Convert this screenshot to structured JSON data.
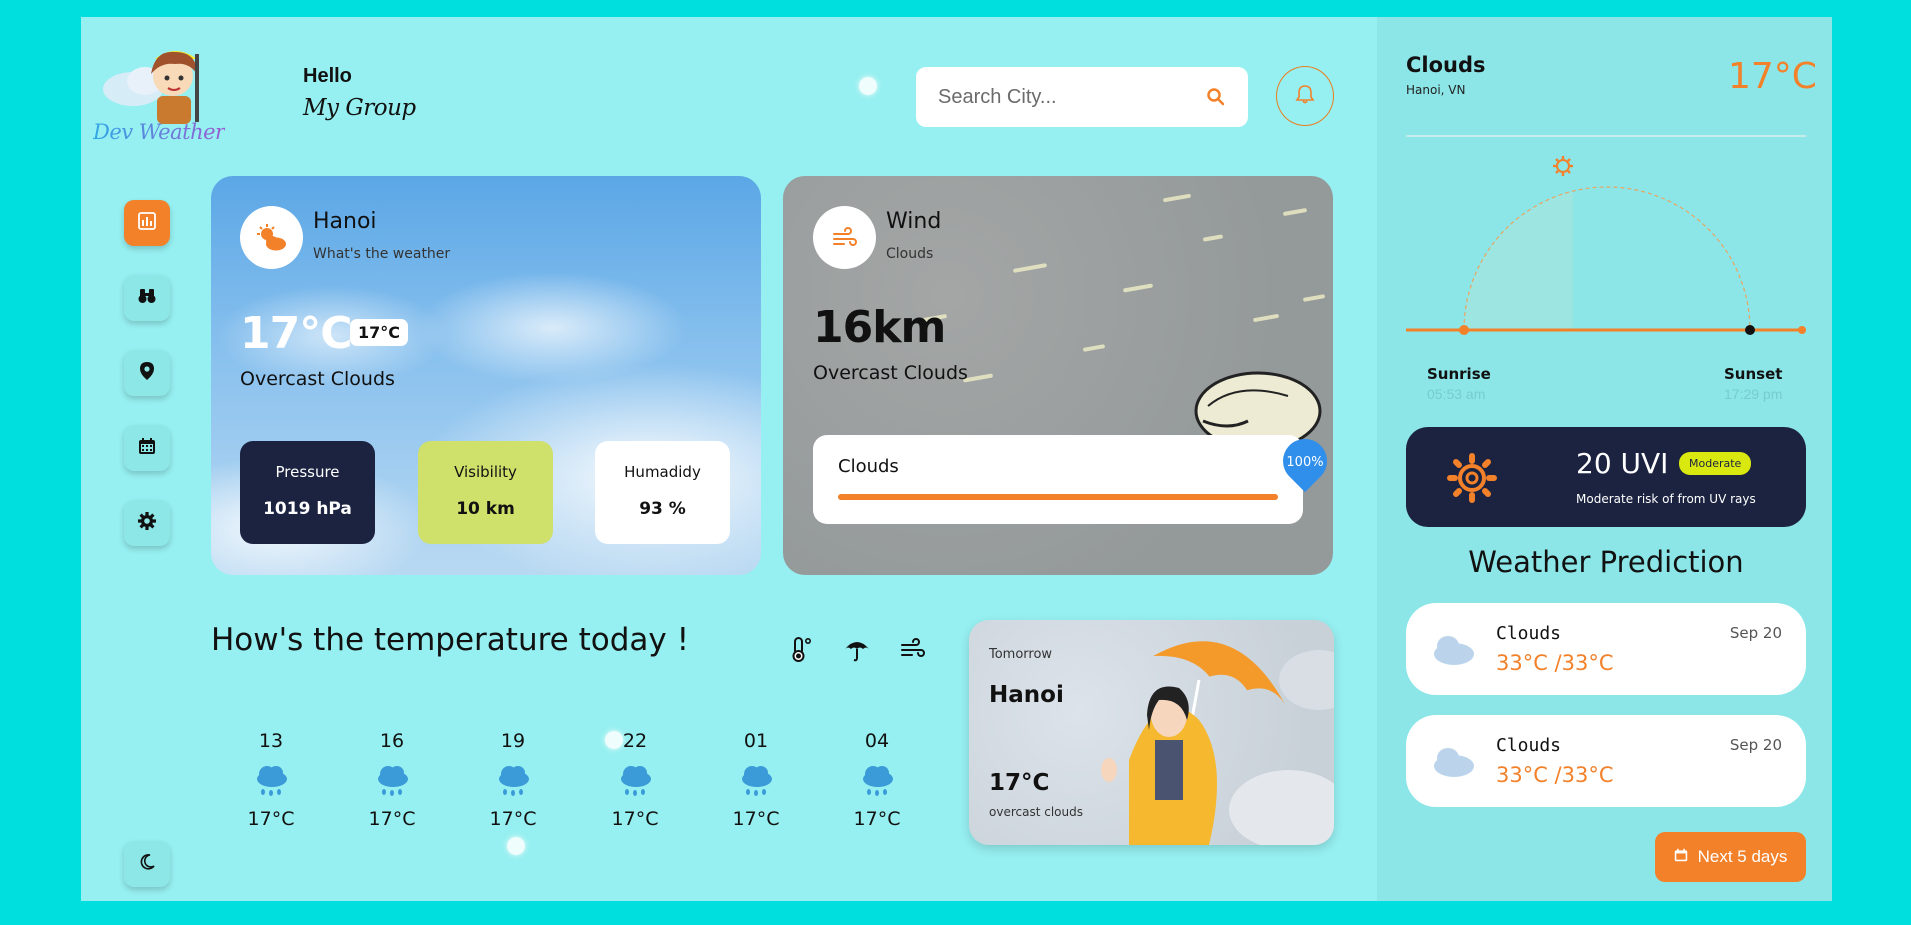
{
  "brand": {
    "name": "Dev Weather"
  },
  "greeting": {
    "hello": "Hello",
    "group": "My Group"
  },
  "search": {
    "placeholder": "Search City..."
  },
  "sidebar": {
    "items": [
      {
        "icon": "bar-chart-icon",
        "active": true
      },
      {
        "icon": "binoculars-icon",
        "active": false
      },
      {
        "icon": "location-pin-icon",
        "active": false
      },
      {
        "icon": "calendar-icon",
        "active": false
      },
      {
        "icon": "gear-icon",
        "active": false
      }
    ],
    "theme_icon": "moon-icon"
  },
  "current": {
    "city": "Hanoi",
    "subtitle": "What's the weather",
    "temp": "17°C",
    "temp_badge": "17°C",
    "description": "Overcast Clouds",
    "stats": [
      {
        "label": "Pressure",
        "value": "1019 hPa"
      },
      {
        "label": "Visibility",
        "value": "10 km"
      },
      {
        "label": "Humadidy",
        "value": "93 %"
      }
    ]
  },
  "wind": {
    "title": "Wind",
    "subtitle": "Clouds",
    "speed": "16km",
    "description": "Overcast Clouds",
    "clouds_label": "Clouds",
    "clouds_percent": "100%",
    "clouds_fraction": 1.0
  },
  "today": {
    "title": "How's the temperature today !",
    "hours": [
      {
        "hour": "13",
        "temp": "17°C"
      },
      {
        "hour": "16",
        "temp": "17°C"
      },
      {
        "hour": "19",
        "temp": "17°C"
      },
      {
        "hour": "22",
        "temp": "17°C"
      },
      {
        "hour": "01",
        "temp": "17°C"
      },
      {
        "hour": "04",
        "temp": "17°C"
      }
    ]
  },
  "tomorrow": {
    "label": "Tomorrow",
    "city": "Hanoi",
    "temp": "17°C",
    "desc": "overcast clouds"
  },
  "panel": {
    "condition": "Clouds",
    "location": "Hanoi, VN",
    "temp": "17°C",
    "sunrise_label": "Sunrise",
    "sunrise_time": "05:53 am",
    "sunset_label": "Sunset",
    "sunset_time": "17:29 pm"
  },
  "uv": {
    "value": "20 UVI",
    "level": "Moderate",
    "desc": "Moderate risk of from UV rays"
  },
  "prediction": {
    "title": "Weather Prediction",
    "items": [
      {
        "condition": "Clouds",
        "date": "Sep 20",
        "range": "33°C /33°C"
      },
      {
        "condition": "Clouds",
        "date": "Sep 20",
        "range": "33°C /33°C"
      }
    ],
    "next_label": "Next 5 days"
  },
  "colors": {
    "accent": "#F2812A",
    "navy": "#1B2340",
    "lime": "#CFE06B",
    "bg": "#96EFF0",
    "frame": "#00DEDE"
  }
}
